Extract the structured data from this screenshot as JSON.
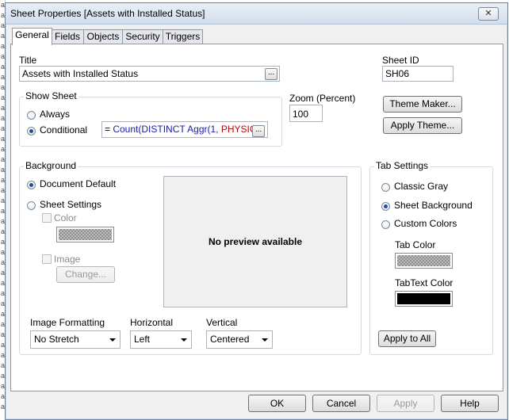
{
  "window": {
    "title": "Sheet Properties [Assets with Installed Status]",
    "close_glyph": "✕"
  },
  "tabs": [
    {
      "label": "General",
      "active": true
    },
    {
      "label": "Fields"
    },
    {
      "label": "Objects"
    },
    {
      "label": "Security"
    },
    {
      "label": "Triggers"
    }
  ],
  "general": {
    "title_label": "Title",
    "title_value": "Assets with Installed Status",
    "ellipsis": "...",
    "sheet_id_label": "Sheet ID",
    "sheet_id_value": "SH06",
    "show_sheet": {
      "legend": "Show Sheet",
      "always_label": "Always",
      "conditional_label": "Conditional",
      "selected": "conditional",
      "condition_prefix": "= ",
      "condition_func": "Count(DISTINCT Aggr(1, ",
      "condition_field": "PHYSIC"
    },
    "zoom_label": "Zoom (Percent)",
    "zoom_value": "100",
    "theme_maker_button": "Theme Maker...",
    "apply_theme_button": "Apply Theme...",
    "background": {
      "legend": "Background",
      "document_default_label": "Document Default",
      "sheet_settings_label": "Sheet Settings",
      "selected": "document_default",
      "color_label": "Color",
      "image_label": "Image",
      "change_button": "Change...",
      "preview_text": "No preview available",
      "image_formatting_label": "Image Formatting",
      "image_formatting_value": "No Stretch",
      "horizontal_label": "Horizontal",
      "horizontal_value": "Left",
      "vertical_label": "Vertical",
      "vertical_value": "Centered"
    },
    "tab_settings": {
      "legend": "Tab Settings",
      "classic_gray_label": "Classic Gray",
      "sheet_background_label": "Sheet Background",
      "custom_colors_label": "Custom Colors",
      "selected": "sheet_background",
      "tab_color_label": "Tab Color",
      "tab_text_color_label": "TabText Color",
      "tab_text_color": "#000000",
      "apply_to_all_button": "Apply to All"
    }
  },
  "footer": {
    "ok": "OK",
    "cancel": "Cancel",
    "apply": "Apply",
    "help": "Help"
  }
}
